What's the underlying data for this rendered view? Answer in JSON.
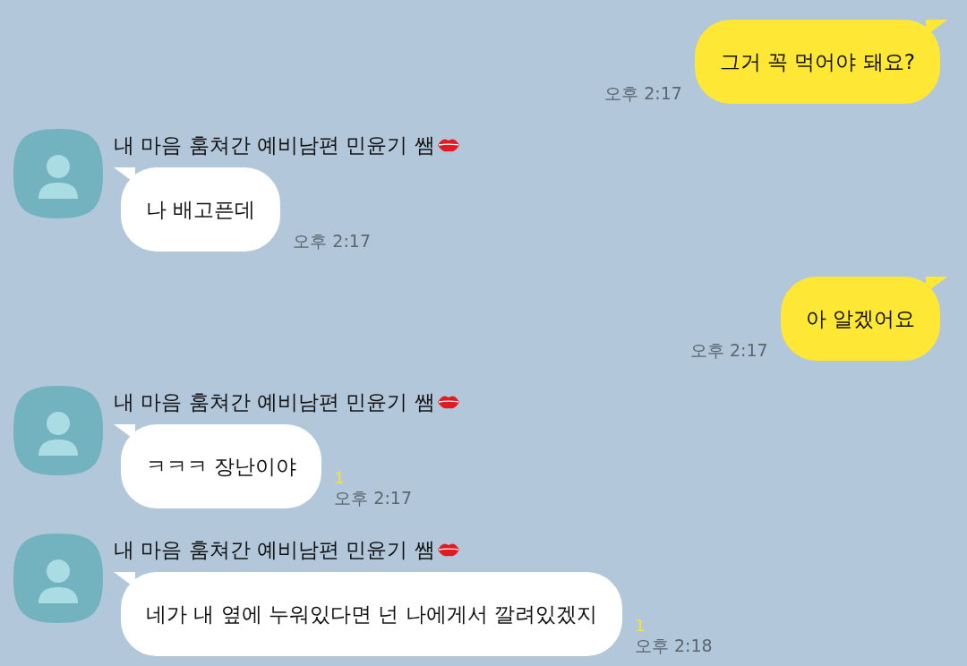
{
  "messages": [
    {
      "kind": "sent",
      "text": "그거 꼭 먹어야 돼요?",
      "time": "오후 2:17"
    },
    {
      "kind": "received",
      "sender": "내 마음 훔쳐간 예비남편 민윤기 쌤",
      "text": "나 배고픈데",
      "time": "오후 2:17"
    },
    {
      "kind": "sent",
      "text": "아 알겠어요",
      "time": "오후 2:17"
    },
    {
      "kind": "received",
      "sender": "내 마음 훔쳐간 예비남편 민윤기 쌤",
      "text": "ㅋㅋㅋ 장난이야",
      "unread": "1",
      "time": "오후 2:17"
    },
    {
      "kind": "received",
      "sender": "내 마음 훔쳐간 예비남편 민윤기 쌤",
      "text": "네가 내 옆에 누워있다면 넌 나에게서 깔려있겠지",
      "unread": "1",
      "time": "오후 2:18"
    }
  ]
}
